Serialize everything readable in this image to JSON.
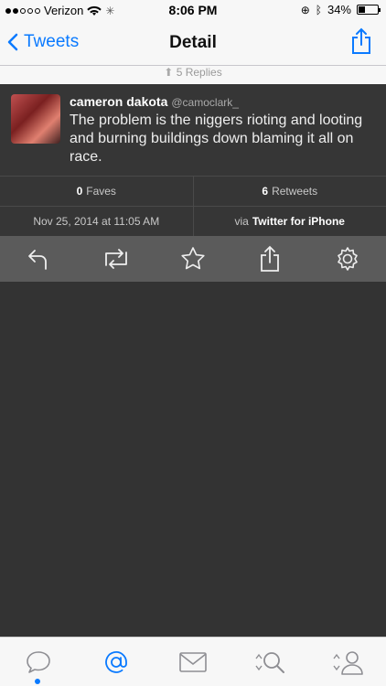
{
  "statusbar": {
    "carrier": "Verizon",
    "time": "8:06 PM",
    "battery": "34%"
  },
  "nav": {
    "back_label": "Tweets",
    "title": "Detail"
  },
  "replies": {
    "label": "5 Replies"
  },
  "tweet": {
    "name": "cameron dakota",
    "handle": "@camoclark_",
    "text": "The problem is the niggers rioting and looting and burning buildings down blaming it all on race."
  },
  "stats": {
    "faves_count": "0",
    "faves_label": "Faves",
    "retweets_count": "6",
    "retweets_label": "Retweets",
    "date": "Nov 25, 2014 at 11:05 AM",
    "via_prefix": "via",
    "via_client": "Twitter for iPhone"
  },
  "colors": {
    "accent": "#0a7aff",
    "background": "#333333"
  }
}
